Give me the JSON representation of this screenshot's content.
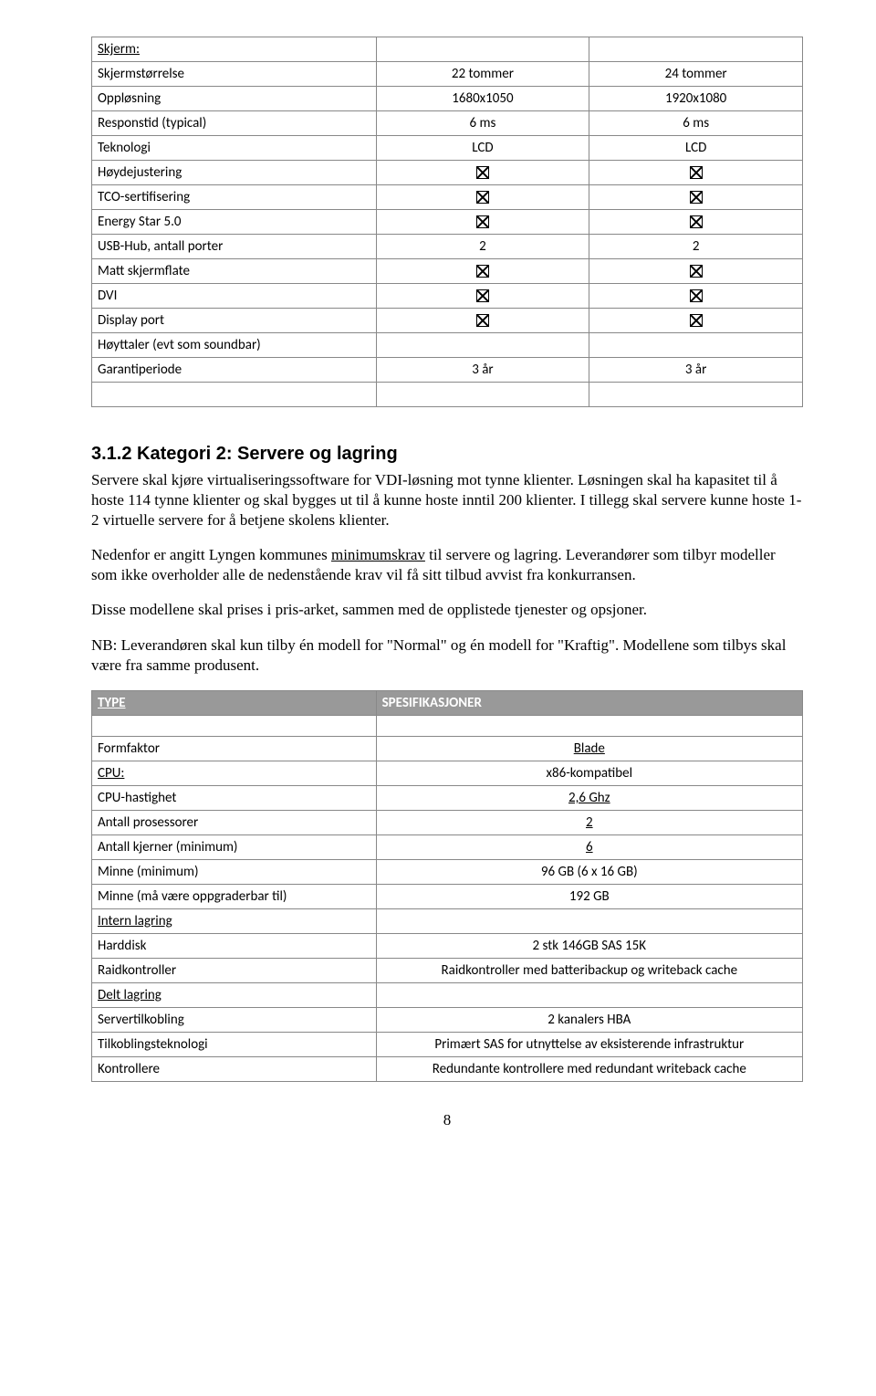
{
  "table1": {
    "header_label": "Skjerm:",
    "rows": [
      {
        "label": "Skjermstørrelse",
        "v1": "22 tommer",
        "v2": "24 tommer"
      },
      {
        "label": "Oppløsning",
        "v1": "1680x1050",
        "v2": "1920x1080"
      },
      {
        "label": "Responstid (typical)",
        "v1": "6 ms",
        "v2": "6 ms"
      },
      {
        "label": "Teknologi",
        "v1": "LCD",
        "v2": "LCD"
      },
      {
        "label": "Høydejustering",
        "v1": "CHECK",
        "v2": "CHECK"
      },
      {
        "label": "TCO-sertifisering",
        "v1": "CHECK",
        "v2": "CHECK"
      },
      {
        "label": "Energy Star 5.0",
        "v1": "CHECK",
        "v2": "CHECK"
      },
      {
        "label": "USB-Hub, antall porter",
        "v1": "2",
        "v2": "2"
      },
      {
        "label": "Matt skjermflate",
        "v1": "CHECK",
        "v2": "CHECK"
      },
      {
        "label": "DVI",
        "v1": "CHECK",
        "v2": "CHECK"
      },
      {
        "label": "Display port",
        "v1": "CHECK",
        "v2": "CHECK"
      },
      {
        "label": "Høyttaler (evt som soundbar)",
        "v1": "",
        "v2": ""
      },
      {
        "label": "Garantiperiode",
        "v1": "3 år",
        "v2": "3 år"
      }
    ]
  },
  "section": {
    "heading": "3.1.2  Kategori 2: Servere og lagring",
    "p1a": "Servere skal kjøre virtualiseringssoftware for VDI-løsning mot tynne klienter. Løsningen skal ha kapasitet til å hoste 114 tynne klienter og skal bygges ut til å kunne hoste inntil 200 klienter. I tillegg skal servere kunne hoste 1-2 virtuelle servere for å betjene skolens klienter.",
    "p2_pre": "Nedenfor er angitt Lyngen kommunes ",
    "p2_u": "minimumskrav",
    "p2_post": " til servere og lagring. Leverandører som tilbyr modeller som ikke overholder alle de nedenstående krav vil få sitt tilbud avvist fra konkurransen.",
    "p3": "Disse modellene skal prises i pris-arket, sammen med de opplistede tjenester og opsjoner.",
    "p4": "NB: Leverandøren skal kun tilby én modell for \"Normal\" og én modell for \"Kraftig\". Modellene som tilbys skal være fra samme produsent."
  },
  "table2": {
    "header_l": "TYPE",
    "header_r": "SPESIFIKASJONER",
    "rows": [
      {
        "label": "Formfaktor",
        "val": "Blade",
        "u": true
      },
      {
        "label": "CPU:",
        "val": "x86-kompatibel",
        "lu": true
      },
      {
        "label": "CPU-hastighet",
        "val": "2,6 Ghz",
        "u": true
      },
      {
        "label": "Antall prosessorer",
        "val": "2",
        "u": true
      },
      {
        "label": "Antall kjerner (minimum)",
        "val": "6",
        "u": true
      },
      {
        "label": "Minne (minimum)",
        "val": "96 GB (6 x 16 GB)"
      },
      {
        "label": "Minne (må være oppgraderbar til)",
        "val": "192 GB"
      },
      {
        "label": "Intern lagring",
        "val": "",
        "lu": true
      },
      {
        "label": "Harddisk",
        "val": "2 stk 146GB SAS 15K"
      },
      {
        "label": "Raidkontroller",
        "val": "Raidkontroller med batteribackup og writeback cache"
      },
      {
        "label": "Delt lagring",
        "val": "",
        "lu": true
      },
      {
        "label": "Servertilkobling",
        "val": "2 kanalers HBA"
      },
      {
        "label": "Tilkoblingsteknologi",
        "val": "Primært SAS for utnyttelse av eksisterende infrastruktur"
      },
      {
        "label": "Kontrollere",
        "val": "Redundante kontrollere med redundant writeback cache"
      }
    ]
  },
  "pagenum": "8"
}
